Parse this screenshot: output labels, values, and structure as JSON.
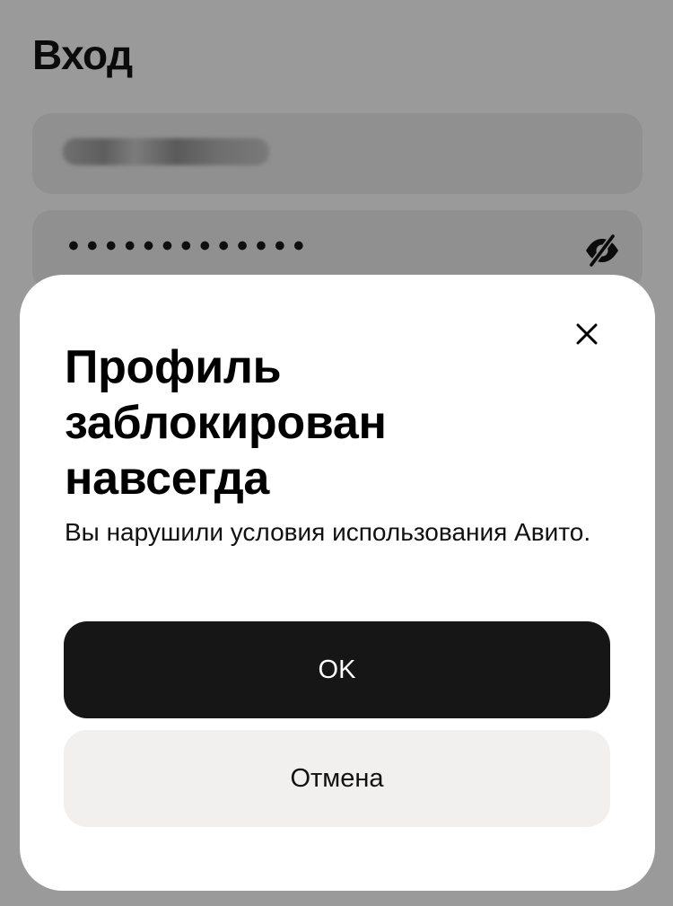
{
  "login": {
    "title": "Вход",
    "password_mask": "•••••••••••••"
  },
  "dialog": {
    "title": "Профиль заблокирован навсегда",
    "message": "Вы нарушили условия использования Авито.",
    "ok_label": "OK",
    "cancel_label": "Отмена"
  },
  "icons": {
    "password_toggle": "eye-off-icon",
    "close": "close-icon"
  },
  "colors": {
    "overlay_background": "#9a9a9a",
    "sheet_background": "#ffffff",
    "primary_button": "#161616",
    "secondary_button": "#f1f0ef"
  }
}
